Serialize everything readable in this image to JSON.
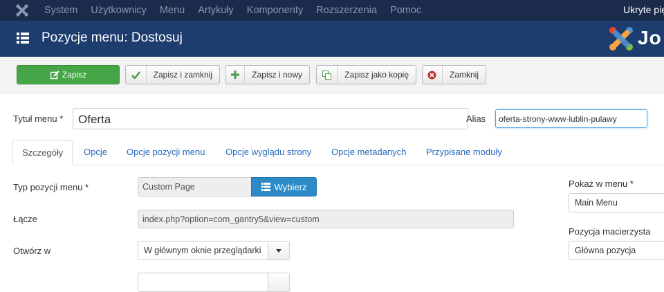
{
  "nav": {
    "items": [
      "System",
      "Użytkownicy",
      "Menu",
      "Artykuły",
      "Komponenty",
      "Rozszerzenia",
      "Pomoc"
    ],
    "right_text": "Ukryte pię"
  },
  "header": {
    "title": "Pozycje menu: Dostosuj",
    "brand_text": "Jo"
  },
  "toolbar": {
    "save": "Zapisz",
    "save_close": "Zapisz i zamknij",
    "save_new": "Zapisz i nowy",
    "save_copy": "Zapisz jako kopię",
    "close": "Zamknij"
  },
  "form": {
    "title_label": "Tytuł menu *",
    "title_value": "Oferta",
    "alias_label": "Alias",
    "alias_value": "oferta-strony-www-lublin-pulawy"
  },
  "tabs": [
    "Szczegóły",
    "Opcje",
    "Opcje pozycji menu",
    "Opcje wyglądu strony",
    "Opcje metadanych",
    "Przypisane moduły"
  ],
  "details": {
    "type_label": "Typ pozycji menu *",
    "type_value": "Custom Page",
    "choose_button": "Wybierz",
    "link_label": "Łącze",
    "link_value": "index.php?option=com_gantry5&view=custom",
    "target_label": "Otwórz w",
    "target_value": "W głównym oknie przeglądarki"
  },
  "sidebar": {
    "menu_label": "Pokaż w menu *",
    "menu_value": "Main Menu",
    "parent_label": "Pozycja macierzysta",
    "parent_value": "Główna pozycja"
  },
  "colors": {
    "nav_bg": "#1a2b4c",
    "header_bg": "#1c3d6e",
    "save_green": "#46a546",
    "primary_blue": "#2d8ac7",
    "link_blue": "#2a6bbf"
  }
}
